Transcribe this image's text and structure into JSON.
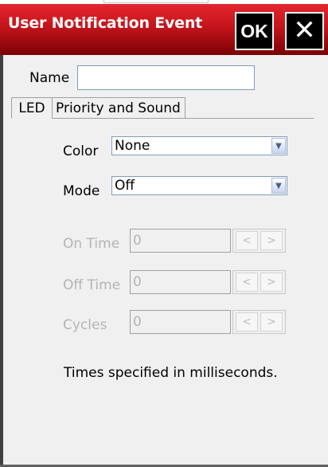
{
  "window": {
    "title": "User Notification Event",
    "ok_label": "OK",
    "close_label": "✕"
  },
  "form": {
    "name_label": "Name",
    "name_value": ""
  },
  "tabs": [
    {
      "label": "LED",
      "selected": true
    },
    {
      "label": "Priority and Sound",
      "selected": false
    }
  ],
  "led": {
    "color_label": "Color",
    "color_value": "None",
    "mode_label": "Mode",
    "mode_value": "Off",
    "on_time_label": "On Time",
    "on_time_value": "0",
    "off_time_label": "Off Time",
    "off_time_value": "0",
    "cycles_label": "Cycles",
    "cycles_value": "0",
    "spin_left": "<",
    "spin_right": ">",
    "note": "Times specified in milliseconds."
  },
  "colors": {
    "titlebar": "#c4141c",
    "disabled_text": "#b4b4b4"
  }
}
